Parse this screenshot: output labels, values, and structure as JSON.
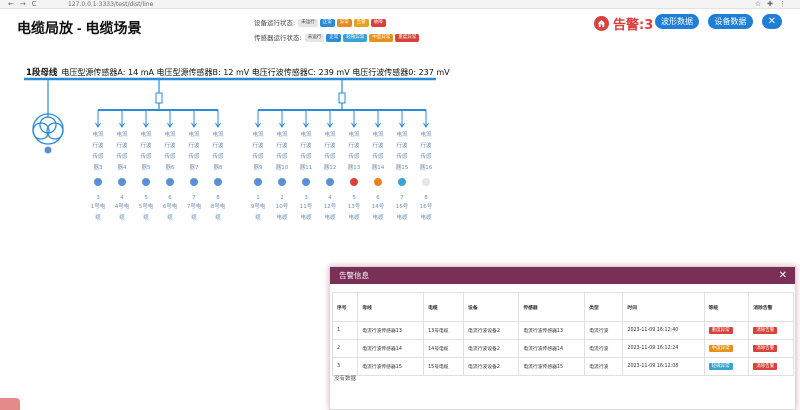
{
  "browser": {
    "url": "127.0.0.1:3333/test/dist/line"
  },
  "page": {
    "title": "电缆局放 - 电缆场景"
  },
  "device_status": {
    "label": "设备运行状态:",
    "items": [
      {
        "text": "未运行",
        "color": "#c8c8c8"
      },
      {
        "text": "正常",
        "color": "#2b8bd6"
      },
      {
        "text": "异常",
        "color": "#e88a1c"
      },
      {
        "text": "告警",
        "color": "#e8a31c"
      },
      {
        "text": "故障",
        "color": "#d9413b"
      }
    ]
  },
  "sensor_status": {
    "label": "传感器运行状态:",
    "items": [
      {
        "text": "未运行",
        "color": "#c8c8c8"
      },
      {
        "text": "正常",
        "color": "#2b8bd6"
      },
      {
        "text": "轻微异常",
        "color": "#38a3d4"
      },
      {
        "text": "中度异常",
        "color": "#e8921c"
      },
      {
        "text": "重度异常",
        "color": "#d9413b"
      }
    ]
  },
  "header": {
    "alarm": "告警:3",
    "wave_btn": "波形数据",
    "device_btn": "设备数据",
    "close_icon": "close-icon"
  },
  "busbar": {
    "name": "1段母线",
    "readings": "电压型源传感器A: 14 mA  电压型源传感器B: 12 mV  电压行波传感器C: 239 mV  电压行波传感器0: 237 mV"
  },
  "left_feeders": [
    {
      "sensor": [
        "电流",
        "行波",
        "传感",
        "器3"
      ],
      "num": "3",
      "cable": [
        "1号电",
        "缆"
      ],
      "color": "#5b8fd6"
    },
    {
      "sensor": [
        "电流",
        "行波",
        "传感",
        "器4"
      ],
      "num": "4",
      "cable": [
        "4号电",
        "缆"
      ],
      "color": "#5b8fd6"
    },
    {
      "sensor": [
        "电流",
        "行波",
        "传感",
        "器5"
      ],
      "num": "5",
      "cable": [
        "5号电",
        "缆"
      ],
      "color": "#5b8fd6"
    },
    {
      "sensor": [
        "电流",
        "行波",
        "传感",
        "器6"
      ],
      "num": "6",
      "cable": [
        "6号电",
        "缆"
      ],
      "color": "#5b8fd6"
    },
    {
      "sensor": [
        "电流",
        "行波",
        "传感",
        "器7"
      ],
      "num": "7",
      "cable": [
        "7号电",
        "缆"
      ],
      "color": "#5b8fd6"
    },
    {
      "sensor": [
        "电流",
        "行波",
        "传感",
        "器8"
      ],
      "num": "8",
      "cable": [
        "8号电",
        "缆"
      ],
      "color": "#5b8fd6"
    }
  ],
  "right_feeders": [
    {
      "sensor": [
        "电流",
        "行波",
        "传感",
        "器9"
      ],
      "num": "1",
      "cable": [
        "9号电",
        "缆"
      ],
      "color": "#5b8fd6"
    },
    {
      "sensor": [
        "电流",
        "行波",
        "传感",
        "器10"
      ],
      "num": "2",
      "cable": [
        "10号",
        "电缆"
      ],
      "color": "#5b8fd6"
    },
    {
      "sensor": [
        "电流",
        "行波",
        "传感",
        "器11"
      ],
      "num": "3",
      "cable": [
        "11号",
        "电缆"
      ],
      "color": "#5b8fd6"
    },
    {
      "sensor": [
        "电流",
        "行波",
        "传感",
        "器12"
      ],
      "num": "4",
      "cable": [
        "12号",
        "电缆"
      ],
      "color": "#5b8fd6"
    },
    {
      "sensor": [
        "电流",
        "行波",
        "传感",
        "器13"
      ],
      "num": "5",
      "cable": [
        "13号",
        "电缆"
      ],
      "color": "#d9413b"
    },
    {
      "sensor": [
        "电流",
        "行波",
        "传感",
        "器14"
      ],
      "num": "6",
      "cable": [
        "14号",
        "电缆"
      ],
      "color": "#e8821c"
    },
    {
      "sensor": [
        "电流",
        "行波",
        "传感",
        "器15"
      ],
      "num": "7",
      "cable": [
        "15号",
        "电缆"
      ],
      "color": "#38a3d4"
    },
    {
      "sensor": [
        "电流",
        "行波",
        "传感",
        "器16"
      ],
      "num": "8",
      "cable": [
        "16号",
        "电缆"
      ],
      "color": "#e6e6e6"
    }
  ],
  "alarm_panel": {
    "title": "告警信息",
    "headers": [
      "序号",
      "母线",
      "电缆",
      "设备",
      "传感器",
      "类型",
      "时间",
      "等级",
      "消除告警"
    ],
    "rows": [
      {
        "idx": "1",
        "bus": "电流行波传感器13",
        "cable": "13号电缆",
        "device": "电流行波设备2",
        "sensor": "电流行波传感器13",
        "type": "电流行波",
        "time": "2023-11-09 16:12:40",
        "level": "重度异常",
        "level_color": "#d9413b",
        "action": "消除告警"
      },
      {
        "idx": "2",
        "bus": "电流行波传感器14",
        "cable": "14号电缆",
        "device": "电流行波设备2",
        "sensor": "电流行波传感器14",
        "type": "电流行波",
        "time": "2023-11-09 16:12:24",
        "level": "中度异常",
        "level_color": "#e8921c",
        "action": "消除告警"
      },
      {
        "idx": "3",
        "bus": "电流行波传感器15",
        "cable": "15号电缆",
        "device": "电流行波设备2",
        "sensor": "电流行波传感器15",
        "type": "电流行波",
        "time": "2023-11-09 16:12:08",
        "level": "轻微异常",
        "level_color": "#38a3d4",
        "action": "消除告警"
      }
    ],
    "no_data": "没有数据"
  }
}
